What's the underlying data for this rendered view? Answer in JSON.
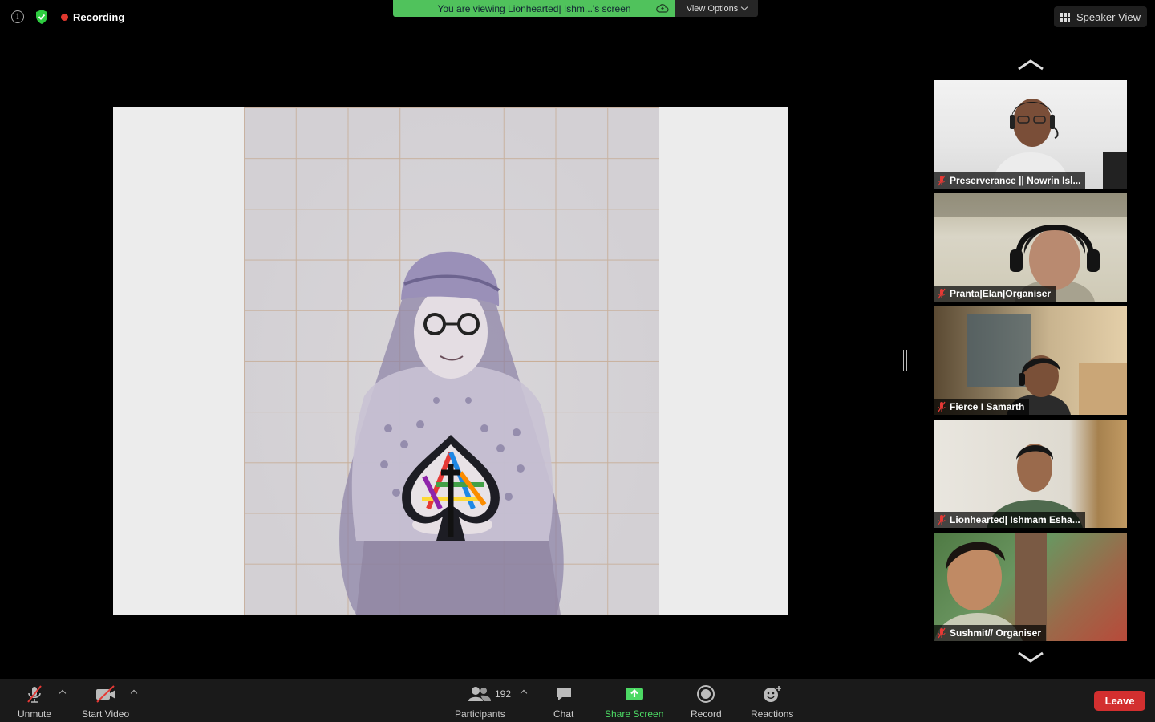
{
  "meeting": {
    "recording_label": "Recording",
    "viewing_banner": "You are viewing Lionhearted| Ishm...'s screen",
    "view_options_label": "View Options",
    "speaker_view_label": "Speaker View"
  },
  "participants_panel": [
    {
      "name": "Preserverance || Nowrin Isl..."
    },
    {
      "name": "Pranta|Elan|Organiser"
    },
    {
      "name": "Fierce I Samarth"
    },
    {
      "name": "Lionhearted| Ishmam Esha..."
    },
    {
      "name": "Sushmit// Organiser"
    }
  ],
  "toolbar": {
    "unmute_label": "Unmute",
    "start_video_label": "Start Video",
    "participants_label": "Participants",
    "participants_count": "192",
    "chat_label": "Chat",
    "share_screen_label": "Share Screen",
    "record_label": "Record",
    "reactions_label": "Reactions",
    "leave_label": "Leave"
  },
  "colors": {
    "share_green": "#4cd964",
    "banner_green": "#50c25c",
    "leave_red": "#d32f2f",
    "recording_red": "#e0382e"
  }
}
